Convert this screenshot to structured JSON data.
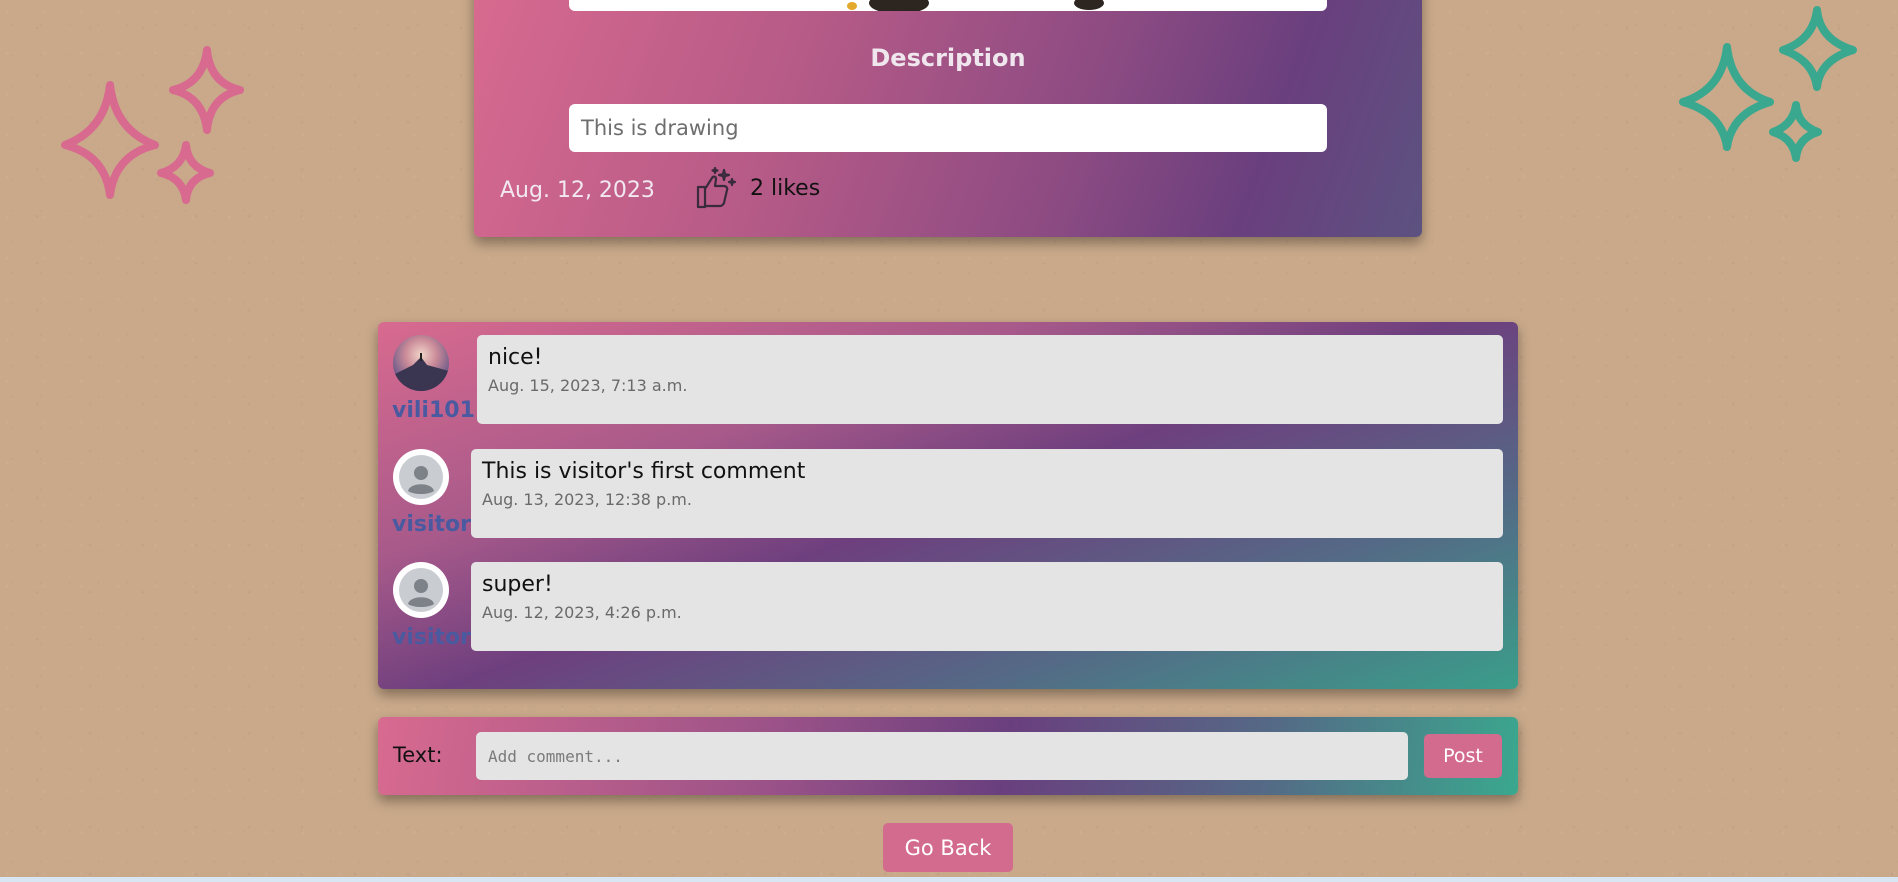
{
  "post": {
    "description_heading": "Description",
    "description_value": "This is drawing",
    "date": "Aug. 12, 2023",
    "likes_label": "2 likes",
    "like_icon": "thumbs-up-sparkle-icon"
  },
  "comments": [
    {
      "username": "vili101",
      "avatar": "user-photo-avatar",
      "text": "nice!",
      "timestamp": "Aug. 15, 2023, 7:13 a.m."
    },
    {
      "username": "visitor",
      "avatar": "default-user-icon",
      "text": "This is visitor's first comment",
      "timestamp": "Aug. 13, 2023, 12:38 p.m."
    },
    {
      "username": "visitor",
      "avatar": "default-user-icon",
      "text": "super!",
      "timestamp": "Aug. 12, 2023, 4:26 p.m."
    }
  ],
  "add_comment": {
    "label": "Text:",
    "placeholder": "Add comment...",
    "value": "",
    "post_label": "Post"
  },
  "navigation": {
    "go_back_label": "Go Back"
  },
  "colors": {
    "pink": "#d86a8f",
    "purple": "#6a3f7e",
    "teal": "#3aa88e",
    "username": "#4a5aa0",
    "button": "#d36b8e"
  }
}
